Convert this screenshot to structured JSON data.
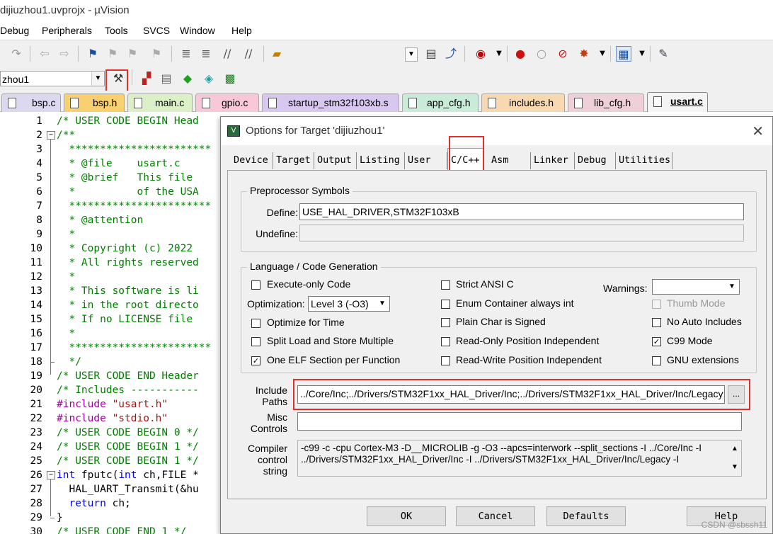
{
  "window": {
    "title": "dijiuzhou1.uvprojx - µVision"
  },
  "menu": [
    "Debug",
    "Peripherals",
    "Tools",
    "SVCS",
    "Window",
    "Help"
  ],
  "toolbar": {
    "target_name": "zhou1"
  },
  "file_tabs": [
    "bsp.c",
    "bsp.h",
    "main.c",
    "gpio.c",
    "startup_stm32f103xb.s",
    "app_cfg.h",
    "includes.h",
    "lib_cfg.h",
    "usart.c"
  ],
  "active_file_tab": "usart.c",
  "editor": {
    "line_numbers": [
      "1",
      "2",
      "3",
      "4",
      "5",
      "6",
      "7",
      "8",
      "9",
      "10",
      "11",
      "12",
      "13",
      "14",
      "15",
      "16",
      "17",
      "18",
      "19",
      "20",
      "21",
      "22",
      "23",
      "24",
      "25",
      "26",
      "27",
      "28",
      "29",
      "30"
    ],
    "lines": [
      "/* USER CODE BEGIN Head",
      "/**",
      "  ***********************",
      "  * @file    usart.c",
      "  * @brief   This file",
      "  *          of the USA",
      "  ***********************",
      "  * @attention",
      "  *",
      "  * Copyright (c) 2022",
      "  * All rights reserved",
      "  *",
      "  * This software is li",
      "  * in the root directo",
      "  * If no LICENSE file",
      "  *",
      "  ***********************",
      "  */",
      "/* USER CODE END Header",
      "/* Includes -----------",
      "#include \"usart.h\"",
      "#include \"stdio.h\"",
      "/* USER CODE BEGIN 0 */",
      "/* USER CODE BEGIN 1 */",
      "/* USER CODE BEGIN 1 */",
      "int fputc(int ch,FILE *",
      "  HAL_UART_Transmit(&hu",
      "  return ch;",
      "}",
      "/* USER CODE END 1 */"
    ]
  },
  "dialog": {
    "title": "Options for Target 'dijiuzhou1'",
    "close_glyph": "✕",
    "tabs": [
      "Device",
      "Target",
      "Output",
      "Listing",
      "User",
      "C/C++",
      "Asm",
      "Linker",
      "Debug",
      "Utilities"
    ],
    "active_tab": "C/C++",
    "preprocessor": {
      "group_title": "Preprocessor Symbols",
      "define_label": "Define:",
      "define_value": "USE_HAL_DRIVER,STM32F103xB",
      "undefine_label": "Undefine:",
      "undefine_value": ""
    },
    "language": {
      "group_title": "Language / Code Generation",
      "checkboxes_left": [
        {
          "label": "Execute-only Code",
          "checked": false
        },
        {
          "label": "Optimize for Time",
          "checked": false
        },
        {
          "label": "Split Load and Store Multiple",
          "checked": false
        },
        {
          "label": "One ELF Section per Function",
          "checked": true
        }
      ],
      "optimization_label": "Optimization:",
      "optimization_value": "Level 3 (-O3)",
      "checkboxes_mid": [
        {
          "label": "Strict ANSI C",
          "checked": false
        },
        {
          "label": "Enum Container always int",
          "checked": false
        },
        {
          "label": "Plain Char is Signed",
          "checked": false
        },
        {
          "label": "Read-Only Position Independent",
          "checked": false
        },
        {
          "label": "Read-Write Position Independent",
          "checked": false
        }
      ],
      "warnings_label": "Warnings:",
      "warnings_value": "",
      "checkboxes_right": [
        {
          "label": "Thumb Mode",
          "checked": false,
          "disabled": true
        },
        {
          "label": "No Auto Includes",
          "checked": false,
          "disabled": false
        },
        {
          "label": "C99 Mode",
          "checked": true,
          "disabled": false
        },
        {
          "label": "GNU extensions",
          "checked": false,
          "disabled": false
        }
      ]
    },
    "include_paths_label_1": "Include",
    "include_paths_label_2": "Paths",
    "include_paths_value": "../Core/Inc;../Drivers/STM32F1xx_HAL_Driver/Inc;../Drivers/STM32F1xx_HAL_Driver/Inc/Legacy;",
    "browse_label": "...",
    "misc_label_1": "Misc",
    "misc_label_2": "Controls",
    "misc_value": "",
    "compiler_label_1": "Compiler",
    "compiler_label_2": "control",
    "compiler_label_3": "string",
    "compiler_line_1": "-c99 -c -cpu Cortex-M3 -D__MICROLIB -g -O3 --apcs=interwork --split_sections -I ../Core/Inc -I",
    "compiler_line_2": "../Drivers/STM32F1xx_HAL_Driver/Inc -I ../Drivers/STM32F1xx_HAL_Driver/Inc/Legacy -I",
    "buttons": {
      "ok": "OK",
      "cancel": "Cancel",
      "defaults": "Defaults",
      "help": "Help"
    }
  },
  "watermark": "CSDN @sbssh11"
}
